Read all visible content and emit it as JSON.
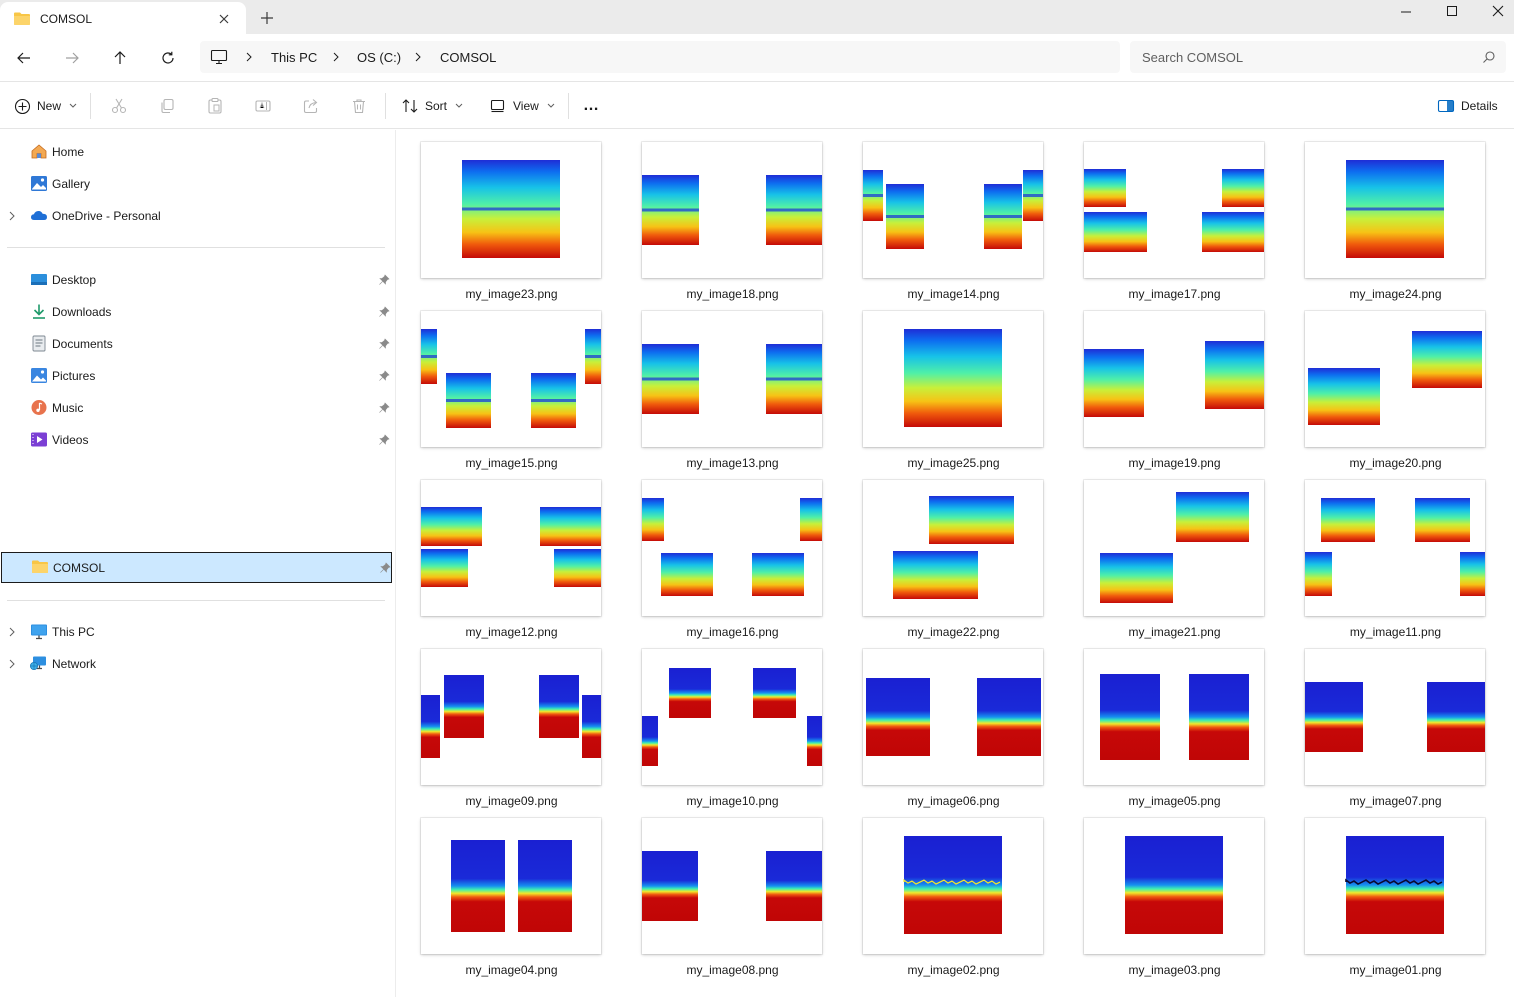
{
  "window": {
    "tab_title": "COMSOL",
    "new_tab_label": "+"
  },
  "address": {
    "crumbs": [
      "This PC",
      "OS (C:)",
      "COMSOL"
    ],
    "search_placeholder": "Search COMSOL"
  },
  "commands": {
    "new": "New",
    "sort": "Sort",
    "view": "View",
    "more": "…",
    "details": "Details"
  },
  "sidebar": {
    "quick": [
      {
        "label": "Home",
        "icon": "home-icon",
        "expandable": false
      },
      {
        "label": "Gallery",
        "icon": "gallery-icon",
        "expandable": false
      },
      {
        "label": "OneDrive - Personal",
        "icon": "onedrive-icon",
        "expandable": true
      }
    ],
    "pinned": [
      {
        "label": "Desktop",
        "icon": "desktop-icon"
      },
      {
        "label": "Downloads",
        "icon": "downloads-icon"
      },
      {
        "label": "Documents",
        "icon": "documents-icon"
      },
      {
        "label": "Pictures",
        "icon": "pictures-icon"
      },
      {
        "label": "Music",
        "icon": "music-icon"
      },
      {
        "label": "Videos",
        "icon": "videos-icon"
      }
    ],
    "selected": {
      "label": "COMSOL",
      "icon": "folder-icon"
    },
    "bottom": [
      {
        "label": "This PC",
        "icon": "this-pc-icon"
      },
      {
        "label": "Network",
        "icon": "network-icon"
      }
    ]
  },
  "files": [
    {
      "name": "my_image23.png"
    },
    {
      "name": "my_image18.png"
    },
    {
      "name": "my_image14.png"
    },
    {
      "name": "my_image17.png"
    },
    {
      "name": "my_image24.png"
    },
    {
      "name": "my_image15.png"
    },
    {
      "name": "my_image13.png"
    },
    {
      "name": "my_image25.png"
    },
    {
      "name": "my_image19.png"
    },
    {
      "name": "my_image20.png"
    },
    {
      "name": "my_image12.png"
    },
    {
      "name": "my_image16.png"
    },
    {
      "name": "my_image22.png"
    },
    {
      "name": "my_image21.png"
    },
    {
      "name": "my_image11.png"
    },
    {
      "name": "my_image09.png"
    },
    {
      "name": "my_image10.png"
    },
    {
      "name": "my_image06.png"
    },
    {
      "name": "my_image05.png"
    },
    {
      "name": "my_image07.png"
    },
    {
      "name": "my_image04.png"
    },
    {
      "name": "my_image08.png"
    },
    {
      "name": "my_image02.png"
    },
    {
      "name": "my_image03.png"
    },
    {
      "name": "my_image01.png"
    }
  ],
  "colors": {
    "selection_bg": "#cce8ff",
    "folder_yellow": "#f8c646",
    "accent_blue": "#0067c0"
  }
}
